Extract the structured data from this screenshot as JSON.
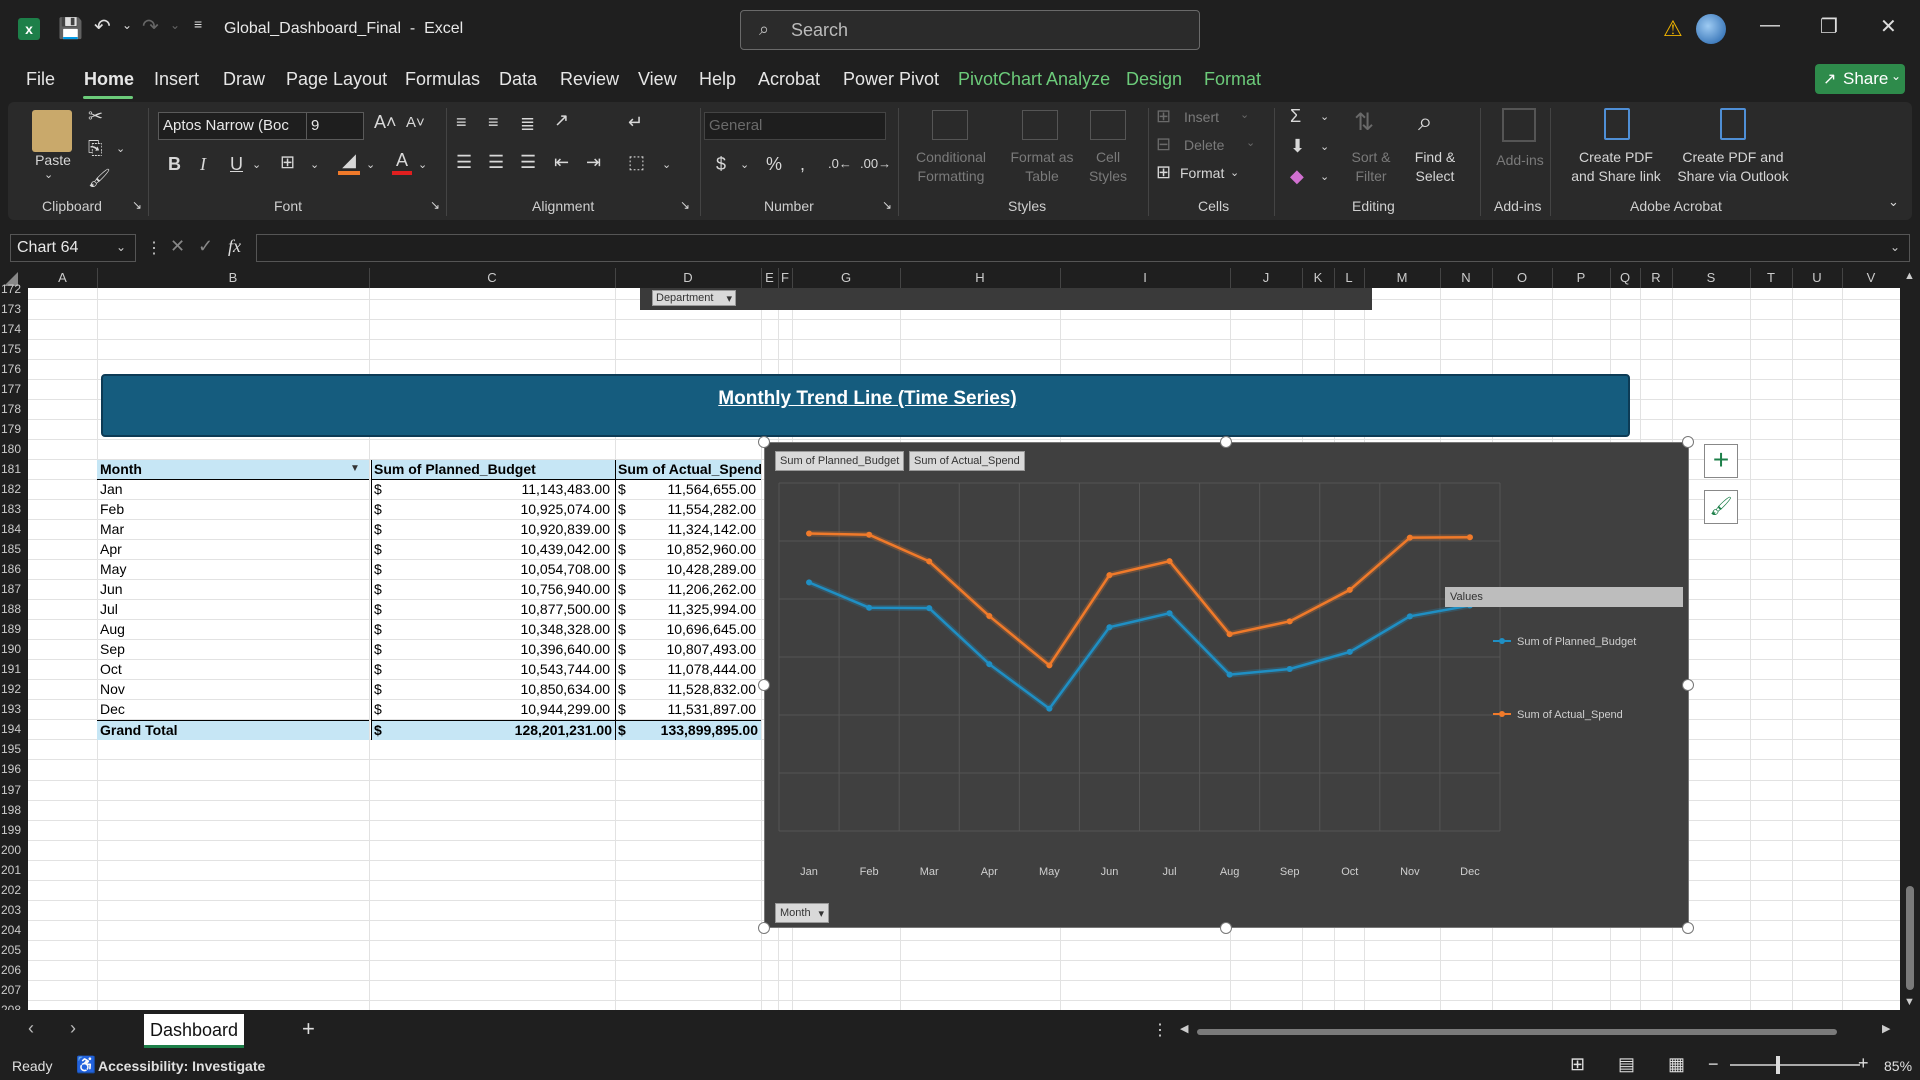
{
  "titlebar": {
    "doc_title": "Global_Dashboard_Final  -  Excel",
    "search_placeholder": "Search"
  },
  "menu": {
    "items": [
      "File",
      "Home",
      "Insert",
      "Draw",
      "Page Layout",
      "Formulas",
      "Data",
      "Review",
      "View",
      "Help",
      "Acrobat",
      "Power Pivot"
    ],
    "context_items": [
      "PivotChart Analyze",
      "Design",
      "Format"
    ],
    "active": "Home",
    "share_label": "Share"
  },
  "ribbon": {
    "clipboard": {
      "paste": "Paste",
      "group": "Clipboard"
    },
    "font": {
      "name": "Aptos Narrow (Boc",
      "size": "9",
      "bold": "B",
      "italic": "I",
      "underline": "U",
      "group": "Font"
    },
    "alignment": {
      "group": "Alignment"
    },
    "number": {
      "format": "General",
      "currency": "$",
      "percent": "%",
      "group": "Number"
    },
    "styles": {
      "conditional": "Conditional\nFormatting",
      "format_table": "Format as\nTable",
      "cell_styles": "Cell\nStyles",
      "group": "Styles"
    },
    "cells": {
      "insert": "Insert",
      "delete": "Delete",
      "format": "Format",
      "group": "Cells"
    },
    "editing": {
      "sort": "Sort &\nFilter",
      "find": "Find &\nSelect",
      "group": "Editing"
    },
    "addins": {
      "label": "Add-ins",
      "group": "Add-ins"
    },
    "acrobat": {
      "create_share": "Create PDF\nand Share link",
      "create_outlook": "Create PDF and\nShare via Outlook",
      "group": "Adobe Acrobat"
    }
  },
  "formula_bar": {
    "name_box": "Chart 64",
    "fx": "fx",
    "formula": ""
  },
  "columns": [
    "A",
    "B",
    "C",
    "D",
    "E",
    "F",
    "G",
    "H",
    "I",
    "J",
    "K",
    "L",
    "M",
    "N",
    "O",
    "P",
    "Q",
    "R",
    "S",
    "T",
    "U",
    "V"
  ],
  "rows": [
    "172",
    "173",
    "174",
    "175",
    "176",
    "177",
    "178",
    "179",
    "180",
    "181",
    "182",
    "183",
    "184",
    "185",
    "186",
    "187",
    "188",
    "189",
    "190",
    "191",
    "192",
    "193",
    "194",
    "195",
    "196",
    "197",
    "198",
    "199",
    "200",
    "201",
    "202",
    "203",
    "204",
    "205",
    "206",
    "207",
    "208"
  ],
  "banner_title": "Monthly Trend Line (Time Series)",
  "department_filter": "Department",
  "pivot": {
    "headers": [
      "Month",
      "Sum of Planned_Budget",
      "Sum of Actual_Spend"
    ],
    "rows": [
      {
        "month": "Jan",
        "planned": "11,143,483.00",
        "actual": "11,564,655.00"
      },
      {
        "month": "Feb",
        "planned": "10,925,074.00",
        "actual": "11,554,282.00"
      },
      {
        "month": "Mar",
        "planned": "10,920,839.00",
        "actual": "11,324,142.00"
      },
      {
        "month": "Apr",
        "planned": "10,439,042.00",
        "actual": "10,852,960.00"
      },
      {
        "month": "May",
        "planned": "10,054,708.00",
        "actual": "10,428,289.00"
      },
      {
        "month": "Jun",
        "planned": "10,756,940.00",
        "actual": "11,206,262.00"
      },
      {
        "month": "Jul",
        "planned": "10,877,500.00",
        "actual": "11,325,994.00"
      },
      {
        "month": "Aug",
        "planned": "10,348,328.00",
        "actual": "10,696,645.00"
      },
      {
        "month": "Sep",
        "planned": "10,396,640.00",
        "actual": "10,807,493.00"
      },
      {
        "month": "Oct",
        "planned": "10,543,744.00",
        "actual": "11,078,444.00"
      },
      {
        "month": "Nov",
        "planned": "10,850,634.00",
        "actual": "11,528,832.00"
      },
      {
        "month": "Dec",
        "planned": "10,944,299.00",
        "actual": "11,531,897.00"
      }
    ],
    "total": {
      "label": "Grand Total",
      "planned": "128,201,231.00",
      "actual": "133,899,895.00"
    },
    "currency": "$"
  },
  "chart_data": {
    "type": "line",
    "categories": [
      "Jan",
      "Feb",
      "Mar",
      "Apr",
      "May",
      "Jun",
      "Jul",
      "Aug",
      "Sep",
      "Oct",
      "Nov",
      "Dec"
    ],
    "series": [
      {
        "name": "Sum of Planned_Budget",
        "color": "#1f8fc4",
        "values": [
          11143483,
          10925074,
          10920839,
          10439042,
          10054708,
          10756940,
          10877500,
          10348328,
          10396640,
          10543744,
          10850634,
          10944299
        ]
      },
      {
        "name": "Sum of Actual_Spend",
        "color": "#f07a2a",
        "values": [
          11564655,
          11554282,
          11324142,
          10852960,
          10428289,
          11206262,
          11325994,
          10696645,
          10807493,
          11078444,
          11528832,
          11531897
        ]
      }
    ],
    "ylim": [
      9000000,
      12000000
    ],
    "legend_title": "Values",
    "legend_position": "right",
    "grid": true,
    "field_buttons": {
      "values": [
        "Sum of Planned_Budget",
        "Sum of Actual_Spend"
      ],
      "axis": "Month"
    }
  },
  "sheet": {
    "tab": "Dashboard"
  },
  "status": {
    "ready": "Ready",
    "accessibility": "Accessibility: Investigate",
    "zoom": "85%"
  },
  "colors": {
    "accent": "#6ccb7a",
    "banner": "#155c7e",
    "header_fill": "#c6e6f5",
    "chart_bg": "#404040"
  }
}
